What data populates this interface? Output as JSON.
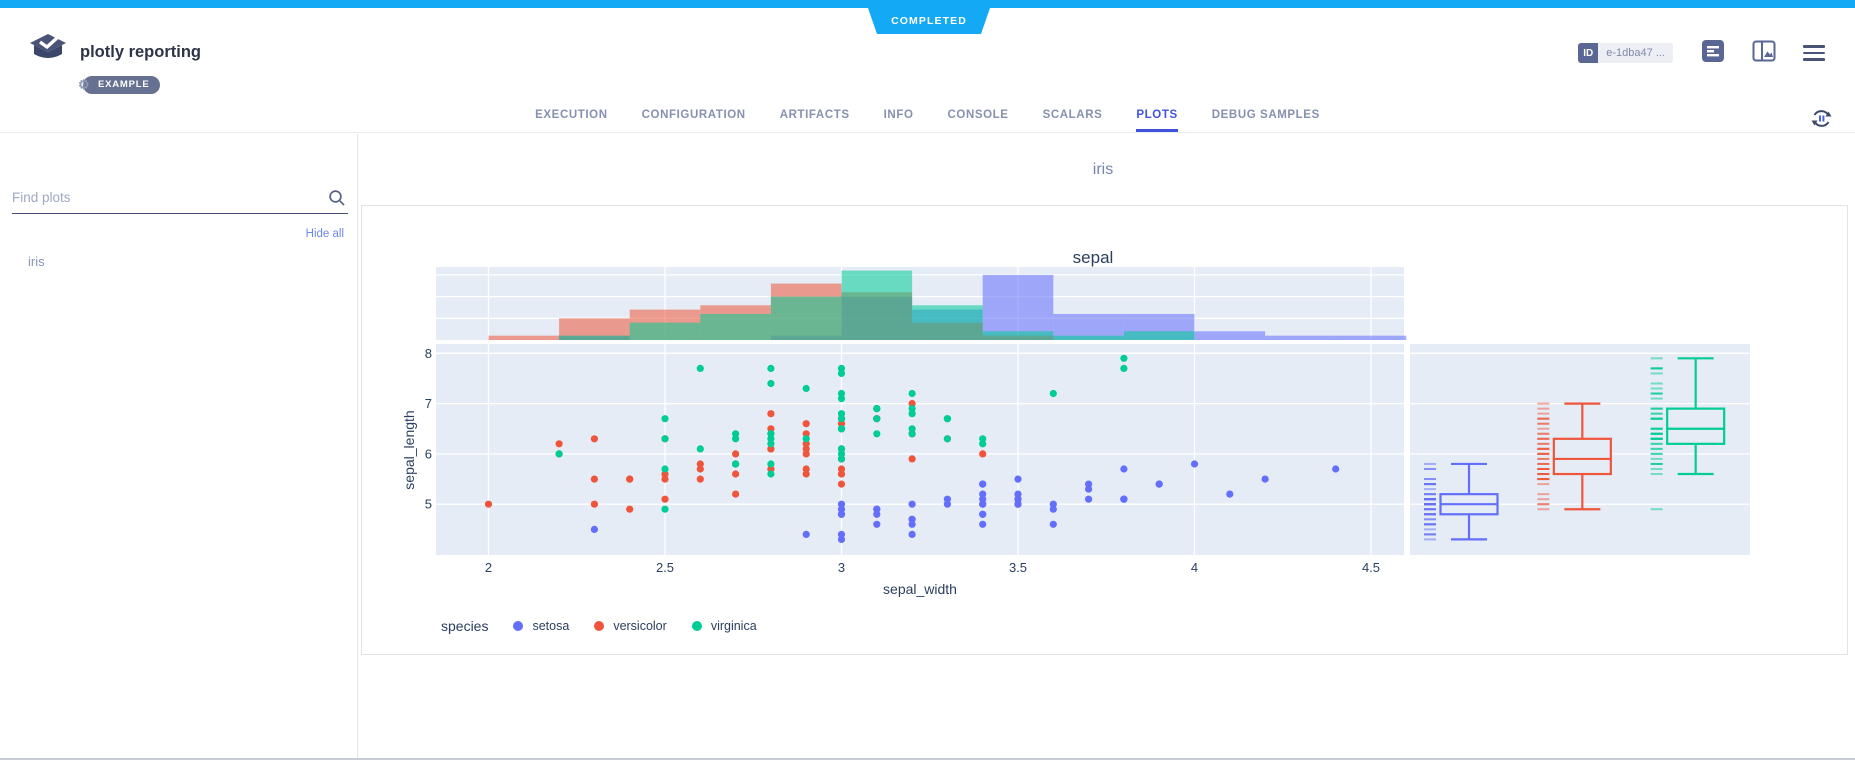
{
  "status": {
    "label": "COMPLETED",
    "color": "#14A9F5"
  },
  "header": {
    "app_title": "plotly reporting",
    "example_badge": "EXAMPLE",
    "id_label": "ID",
    "id_value": "e-1dba47 ...",
    "icons": [
      "clearml-logo-icon",
      "gear-icon",
      "details-icon",
      "split-view-icon",
      "menu-icon"
    ]
  },
  "tabs": {
    "items": [
      "EXECUTION",
      "CONFIGURATION",
      "ARTIFACTS",
      "INFO",
      "CONSOLE",
      "SCALARS",
      "PLOTS",
      "DEBUG SAMPLES"
    ],
    "active_index": 6,
    "active_color": "#4053e0",
    "refresh_icon": "auto-refresh-icon"
  },
  "sidebar": {
    "search_placeholder": "Find plots",
    "search_icon": "search-icon",
    "hide_all_label": "Hide all",
    "items": [
      "iris"
    ]
  },
  "main": {
    "section_title": "iris"
  },
  "chart_data": {
    "type": "scatter",
    "title": "sepal",
    "xlabel": "sepal_width",
    "ylabel": "sepal_length",
    "legend_title": "species",
    "legend_position": "bottom-left",
    "grid": true,
    "plot_bg": "#E5ECF6",
    "x_ticks": [
      2,
      2.5,
      3,
      3.5,
      4,
      4.5
    ],
    "y_ticks": [
      5,
      6,
      7,
      8
    ],
    "x_range": [
      1.85,
      4.6
    ],
    "y_range": [
      4.0,
      8.2
    ],
    "marginal_x": "histogram",
    "marginal_y": "rug-and-box",
    "histogram": {
      "bin_start": 2.0,
      "bin_size": 0.2,
      "gridline_counts": [
        5,
        10,
        15
      ],
      "count_range": [
        0,
        17
      ]
    },
    "series": [
      {
        "name": "setosa",
        "color": "#636EFA",
        "x": [
          3.5,
          3.0,
          3.2,
          3.1,
          3.6,
          3.9,
          3.4,
          3.4,
          2.9,
          3.1,
          3.7,
          3.4,
          3.0,
          3.0,
          4.0,
          4.4,
          3.9,
          3.5,
          3.8,
          3.8,
          3.4,
          3.7,
          3.6,
          3.3,
          3.4,
          3.0,
          3.4,
          3.5,
          3.4,
          3.2,
          3.1,
          3.4,
          4.1,
          4.2,
          3.1,
          3.2,
          3.5,
          3.6,
          3.0,
          3.4,
          3.5,
          2.3,
          3.2,
          3.5,
          3.8,
          3.0,
          3.8,
          3.2,
          3.7,
          3.3
        ],
        "y": [
          5.1,
          4.9,
          4.7,
          4.6,
          5.0,
          5.4,
          4.6,
          5.0,
          4.4,
          4.9,
          5.4,
          4.8,
          4.8,
          4.3,
          5.8,
          5.7,
          5.4,
          5.1,
          5.7,
          5.1,
          5.4,
          5.1,
          4.6,
          5.1,
          4.8,
          5.0,
          5.0,
          5.2,
          5.2,
          4.7,
          4.8,
          5.4,
          5.2,
          5.5,
          4.9,
          5.0,
          5.5,
          4.9,
          4.4,
          5.1,
          5.0,
          4.5,
          4.4,
          5.0,
          5.1,
          4.8,
          5.1,
          4.6,
          5.3,
          5.0
        ],
        "hist_bins": [
          0,
          1,
          0,
          0,
          1,
          10,
          7,
          15,
          6,
          6,
          2,
          1,
          1
        ],
        "box": {
          "whisker_low": 4.3,
          "q1": 4.8,
          "median": 5.0,
          "q3": 5.2,
          "whisker_high": 5.8
        }
      },
      {
        "name": "versicolor",
        "color": "#EF553B",
        "x": [
          3.2,
          3.2,
          3.1,
          2.3,
          2.8,
          2.8,
          3.3,
          2.4,
          2.9,
          2.7,
          2.0,
          3.0,
          2.2,
          2.9,
          2.9,
          3.1,
          3.0,
          2.7,
          2.2,
          2.5,
          3.2,
          2.8,
          2.5,
          2.8,
          2.9,
          3.0,
          2.8,
          3.0,
          2.9,
          2.6,
          2.4,
          2.4,
          2.7,
          2.7,
          3.0,
          3.4,
          3.1,
          2.3,
          3.0,
          2.5,
          2.6,
          3.0,
          2.6,
          2.3,
          2.7,
          3.0,
          2.9,
          2.9,
          2.5,
          2.8
        ],
        "y": [
          7.0,
          6.4,
          6.9,
          5.5,
          6.5,
          5.7,
          6.3,
          4.9,
          6.6,
          5.2,
          5.0,
          5.9,
          6.0,
          6.1,
          5.6,
          6.7,
          5.6,
          5.8,
          6.2,
          5.6,
          5.9,
          6.1,
          6.3,
          6.1,
          6.4,
          6.6,
          6.8,
          6.7,
          6.0,
          5.7,
          5.5,
          5.5,
          5.8,
          6.0,
          5.4,
          6.0,
          6.7,
          6.3,
          5.6,
          5.5,
          5.5,
          6.1,
          5.8,
          5.0,
          5.6,
          5.7,
          5.7,
          6.2,
          5.1,
          5.7
        ],
        "hist_bins": [
          1,
          5,
          7,
          8,
          13,
          11,
          4,
          1,
          0,
          0,
          0,
          0,
          0
        ],
        "box": {
          "whisker_low": 4.9,
          "q1": 5.6,
          "median": 5.9,
          "q3": 6.3,
          "whisker_high": 7.0
        }
      },
      {
        "name": "virginica",
        "color": "#00CC96",
        "x": [
          3.3,
          2.7,
          3.0,
          2.9,
          3.0,
          3.0,
          2.5,
          2.9,
          2.5,
          3.6,
          3.2,
          2.7,
          3.0,
          2.5,
          2.8,
          3.2,
          3.0,
          3.8,
          2.6,
          2.2,
          3.2,
          2.8,
          2.8,
          2.7,
          3.3,
          3.2,
          2.8,
          3.0,
          2.8,
          3.0,
          2.8,
          3.8,
          2.8,
          2.8,
          2.6,
          3.0,
          3.4,
          3.1,
          3.0,
          3.1,
          3.1,
          3.1,
          2.7,
          3.2,
          3.3,
          3.0,
          2.5,
          3.0,
          3.4,
          3.0
        ],
        "y": [
          6.3,
          5.8,
          7.1,
          6.3,
          6.5,
          7.6,
          4.9,
          7.3,
          6.7,
          7.2,
          6.5,
          6.4,
          6.8,
          5.7,
          5.8,
          6.4,
          6.5,
          7.7,
          7.7,
          6.0,
          6.9,
          5.6,
          7.7,
          6.3,
          6.7,
          7.2,
          6.2,
          6.1,
          6.4,
          7.2,
          7.4,
          7.9,
          6.4,
          6.3,
          6.1,
          7.7,
          6.3,
          6.4,
          6.0,
          6.9,
          6.7,
          6.9,
          5.8,
          6.8,
          6.7,
          6.7,
          6.3,
          6.5,
          6.2,
          5.9
        ],
        "hist_bins": [
          0,
          1,
          4,
          6,
          10,
          16,
          8,
          2,
          1,
          2,
          0,
          0,
          0
        ],
        "box": {
          "whisker_low": 5.6,
          "q1": 6.2,
          "median": 6.5,
          "q3": 6.9,
          "whisker_high": 7.9
        }
      }
    ]
  }
}
